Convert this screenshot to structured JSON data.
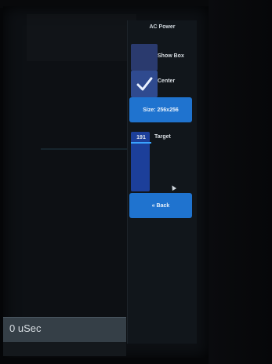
{
  "panel": {
    "title": "AC Power",
    "show_box": {
      "label": "Show Box",
      "checked": false
    },
    "center": {
      "label": "Center",
      "checked": true
    },
    "size_button": "Size: 256x256",
    "target": {
      "value": "191",
      "label": "Target"
    },
    "back_button": "« Back"
  },
  "status": {
    "text": "0 uSec"
  },
  "colors": {
    "panel_bg": "#11161b",
    "button_blue": "#1f73cf",
    "checkbox_blue": "#2a3a6e",
    "slider_blue": "#1c3f9a",
    "status_bar": "#353f47"
  }
}
